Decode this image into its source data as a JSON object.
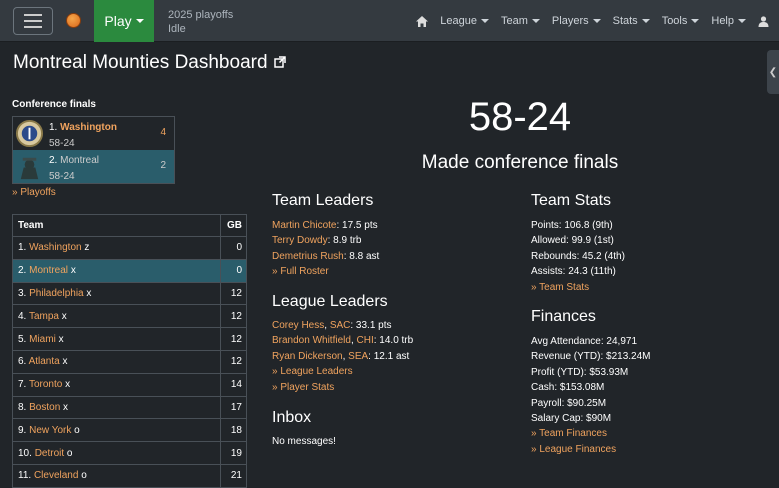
{
  "nav": {
    "play_label": "Play",
    "status_line1": "2025 playoffs",
    "status_line2": "Idle",
    "menu": [
      "League",
      "Team",
      "Players",
      "Stats",
      "Tools",
      "Help"
    ]
  },
  "page": {
    "title": "Montreal Mounties Dashboard"
  },
  "playoffs": {
    "round_label": "Conference finals",
    "series": [
      {
        "seed": "1.",
        "team": "Washington",
        "record": "58-24",
        "wins": "4",
        "winner": true
      },
      {
        "seed": "2.",
        "team": "Montreal",
        "record": "58-24",
        "wins": "2",
        "winner": false
      }
    ],
    "link": "» Playoffs"
  },
  "standings": {
    "headers": [
      "Team",
      "GB"
    ],
    "rows": [
      {
        "rank": "1.",
        "team": "Washington",
        "mark": "z",
        "gb": "0"
      },
      {
        "rank": "2.",
        "team": "Montreal",
        "mark": "x",
        "gb": "0"
      },
      {
        "rank": "3.",
        "team": "Philadelphia",
        "mark": "x",
        "gb": "12"
      },
      {
        "rank": "4.",
        "team": "Tampa",
        "mark": "x",
        "gb": "12"
      },
      {
        "rank": "5.",
        "team": "Miami",
        "mark": "x",
        "gb": "12"
      },
      {
        "rank": "6.",
        "team": "Atlanta",
        "mark": "x",
        "gb": "12"
      },
      {
        "rank": "7.",
        "team": "Toronto",
        "mark": "x",
        "gb": "14"
      },
      {
        "rank": "8.",
        "team": "Boston",
        "mark": "x",
        "gb": "17"
      },
      {
        "rank": "9.",
        "team": "New York",
        "mark": "o",
        "gb": "18"
      },
      {
        "rank": "10.",
        "team": "Detroit",
        "mark": "o",
        "gb": "19"
      },
      {
        "rank": "11.",
        "team": "Cleveland",
        "mark": "o",
        "gb": "21"
      }
    ]
  },
  "summary": {
    "record": "58-24",
    "result": "Made conference finals"
  },
  "team_leaders": {
    "title": "Team Leaders",
    "items": [
      {
        "name": "Martin Chicote",
        "stat": ": 17.5 pts"
      },
      {
        "name": "Terry Dowdy",
        "stat": ": 8.9 trb"
      },
      {
        "name": "Demetrius Rush",
        "stat": ": 8.8 ast"
      }
    ],
    "link": "» Full Roster"
  },
  "league_leaders": {
    "title": "League Leaders",
    "items": [
      {
        "name": "Corey Hess",
        "team": "SAC",
        "stat": ": 33.1 pts"
      },
      {
        "name": "Brandon Whitfield",
        "team": "CHI",
        "stat": ": 14.0 trb"
      },
      {
        "name": "Ryan Dickerson",
        "team": "SEA",
        "stat": ": 12.1 ast"
      }
    ],
    "links": [
      "» League Leaders",
      "» Player Stats"
    ]
  },
  "inbox": {
    "title": "Inbox",
    "message": "No messages!"
  },
  "team_stats": {
    "title": "Team Stats",
    "lines": [
      "Points: 106.8 (9th)",
      "Allowed: 99.9 (1st)",
      "Rebounds: 45.2 (4th)",
      "Assists: 24.3 (11th)"
    ],
    "link": "» Team Stats"
  },
  "finances": {
    "title": "Finances",
    "lines": [
      "Avg Attendance: 24,971",
      "Revenue (YTD): $213.24M",
      "Profit (YTD): $53.93M",
      "Cash: $153.08M",
      "Payroll: $90.25M",
      "Salary Cap: $90M"
    ],
    "links": [
      "» Team Finances",
      "» League Finances"
    ]
  },
  "colors": {
    "background": "#212529",
    "navbar": "#343a40",
    "play_button": "#2b8a3e",
    "link": "#f0a35e",
    "highlight_row": "#2a5d6b"
  }
}
